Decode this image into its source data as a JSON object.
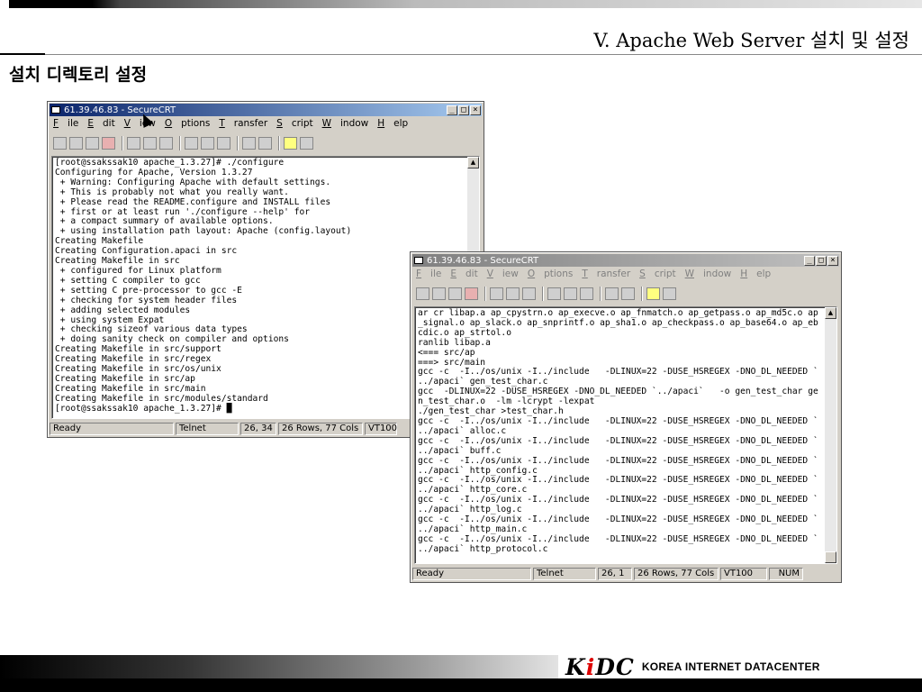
{
  "slide": {
    "title": "V. Apache Web Server 설치 및 설정",
    "heading": "설치 디렉토리 설정"
  },
  "window1": {
    "title": "61.39.46.83 - SecureCRT",
    "menu": [
      "File",
      "Edit",
      "View",
      "Options",
      "Transfer",
      "Script",
      "Window",
      "Help"
    ],
    "terminal_lines": [
      "[root@ssakssak10 apache_1.3.27]# ./configure",
      "Configuring for Apache, Version 1.3.27",
      " + Warning: Configuring Apache with default settings.",
      " + This is probably not what you really want.",
      " + Please read the README.configure and INSTALL files",
      " + first or at least run './configure --help' for",
      " + a compact summary of available options.",
      " + using installation path layout: Apache (config.layout)",
      "Creating Makefile",
      "Creating Configuration.apaci in src",
      "Creating Makefile in src",
      " + configured for Linux platform",
      " + setting C compiler to gcc",
      " + setting C pre-processor to gcc -E",
      " + checking for system header files",
      " + adding selected modules",
      " + using system Expat",
      " + checking sizeof various data types",
      " + doing sanity check on compiler and options",
      "Creating Makefile in src/support",
      "Creating Makefile in src/regex",
      "Creating Makefile in src/os/unix",
      "Creating Makefile in src/ap",
      "Creating Makefile in src/main",
      "Creating Makefile in src/modules/standard",
      "[root@ssakssak10 apache_1.3.27]# █"
    ],
    "status": [
      "Ready",
      "Telnet",
      "26, 34",
      "26 Rows, 77 Cols",
      "VT100"
    ]
  },
  "window2": {
    "title": "61.39.46.83 - SecureCRT",
    "menu": [
      "File",
      "Edit",
      "View",
      "Options",
      "Transfer",
      "Script",
      "Window",
      "Help"
    ],
    "terminal_lines": [
      "ar cr libap.a ap_cpystrn.o ap_execve.o ap_fnmatch.o ap_getpass.o ap_md5c.o ap",
      "_signal.o ap_slack.o ap_snprintf.o ap_sha1.o ap_checkpass.o ap_base64.o ap_eb",
      "cdic.o ap_strtol.o",
      "ranlib libap.a",
      "<=== src/ap",
      "===> src/main",
      "gcc -c  -I../os/unix -I../include   -DLINUX=22 -DUSE_HSREGEX -DNO_DL_NEEDED `",
      "../apaci` gen_test_char.c",
      "gcc  -DLINUX=22 -DUSE_HSREGEX -DNO_DL_NEEDED `../apaci`   -o gen_test_char ge",
      "n_test_char.o  -lm -lcrypt -lexpat",
      "./gen_test_char >test_char.h",
      "gcc -c  -I../os/unix -I../include   -DLINUX=22 -DUSE_HSREGEX -DNO_DL_NEEDED `",
      "../apaci` alloc.c",
      "gcc -c  -I../os/unix -I../include   -DLINUX=22 -DUSE_HSREGEX -DNO_DL_NEEDED `",
      "../apaci` buff.c",
      "gcc -c  -I../os/unix -I../include   -DLINUX=22 -DUSE_HSREGEX -DNO_DL_NEEDED `",
      "../apaci` http_config.c",
      "gcc -c  -I../os/unix -I../include   -DLINUX=22 -DUSE_HSREGEX -DNO_DL_NEEDED `",
      "../apaci` http_core.c",
      "gcc -c  -I../os/unix -I../include   -DLINUX=22 -DUSE_HSREGEX -DNO_DL_NEEDED `",
      "../apaci` http_log.c",
      "gcc -c  -I../os/unix -I../include   -DLINUX=22 -DUSE_HSREGEX -DNO_DL_NEEDED `",
      "../apaci` http_main.c",
      "gcc -c  -I../os/unix -I../include   -DLINUX=22 -DUSE_HSREGEX -DNO_DL_NEEDED `",
      "../apaci` http_protocol.c"
    ],
    "status": [
      "Ready",
      "Telnet",
      "26,  1",
      "26 Rows,  77 Cols",
      "VT100",
      "NUM"
    ]
  },
  "footer": {
    "logo_k": "K",
    "logo_i": "i",
    "logo_dc": "DC",
    "logo_text": "KOREA INTERNET DATACENTER"
  },
  "icons": {
    "toolbar": [
      "connect-icon",
      "quick-connect-icon",
      "reconnect-icon",
      "disconnect-icon",
      "copy-icon",
      "paste-icon",
      "find-icon",
      "print-icon",
      "print-setup-icon",
      "options-icon",
      "settings-icon",
      "help-icon",
      "about-icon"
    ]
  }
}
